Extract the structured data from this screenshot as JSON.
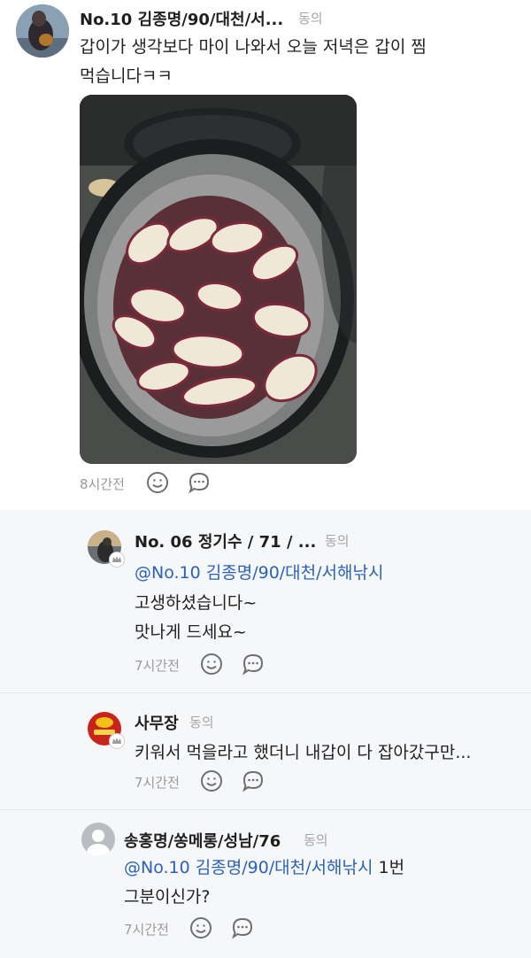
{
  "main_comment": {
    "author": "No.10 김종명/90/대천/서...",
    "tag": "동의",
    "text_line1": "갑이가 생각보다 마이 나와서 오늘 저녁은 갑이 찜",
    "text_line2": "먹습니다ㅋㅋ",
    "photo_caption": "steamed-crabs-photo",
    "time": "8시간전"
  },
  "replies": [
    {
      "author": "No. 06 정기수 / 71 / ...",
      "tag": "동의",
      "mention": "@No.10 김종명/90/대천/서해낚시",
      "line1": "고생하셨습니다~",
      "line2": "맛나게 드세요~",
      "time": "7시간전"
    },
    {
      "author": "사무장",
      "tag": "동의",
      "line1": "키워서 먹을라고 했더니 내갑이 다 잡아갔구만...",
      "time": "7시간전"
    },
    {
      "author": "송홍명/쏭메롱/성남/76",
      "tag": "동의",
      "mention": "@No.10 김종명/90/대천/서해낚시",
      "mention_suffix": " 1번",
      "line2": "그분이신가?",
      "time": "7시간전"
    }
  ],
  "colors": {
    "mention": "#2b62b6",
    "reply_background": "#f6f7f9",
    "icon_gray": "#6f6f6f"
  }
}
